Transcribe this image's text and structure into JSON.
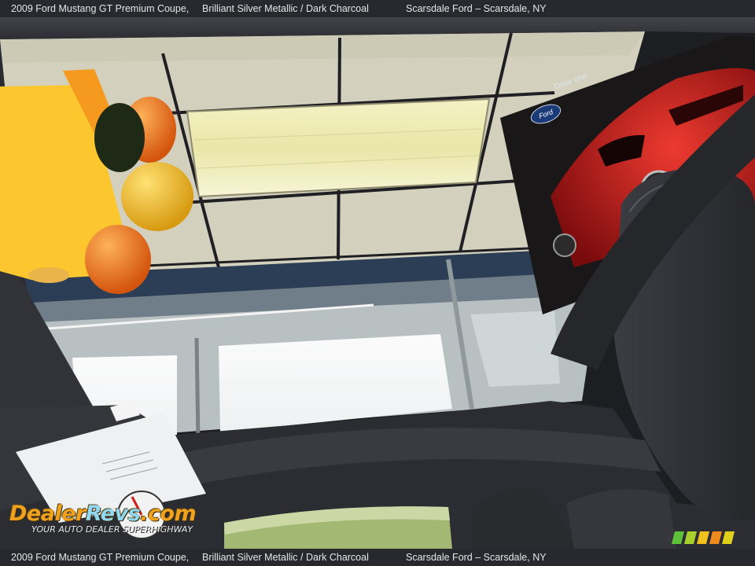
{
  "caption": {
    "title": "2009 Ford Mustang GT Premium Coupe,",
    "color": "Brilliant Silver Metallic / Dark Charcoal",
    "dealer": "Scarsdale Ford – Scarsdale, NY"
  },
  "watermark": {
    "logo_dealer": "Dealer",
    "logo_revs": "Revs",
    "logo_com": ".com",
    "tagline": "YOUR AUTO DEALER SUPERHIGHWAY"
  },
  "poster": {
    "slogan": "Drive one.",
    "brand": "Ford"
  },
  "colors": {
    "sticky_note": "#fcc72e",
    "headliner": "#3a3b40",
    "seat": "#2f3034",
    "ceiling_tile": "#d9d6c4",
    "car_red": "#c8171b"
  }
}
